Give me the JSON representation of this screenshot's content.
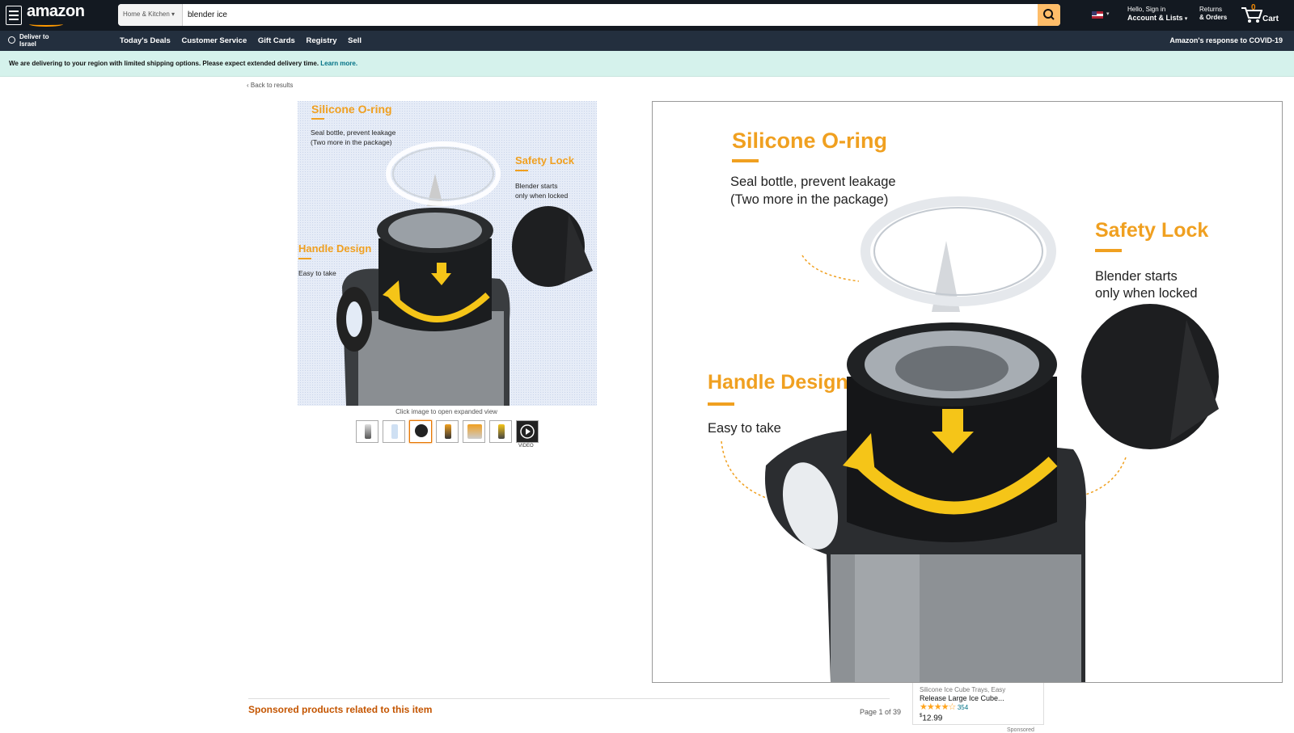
{
  "header": {
    "logo": "amazon",
    "search_category": "Home & Kitchen",
    "search_query": "blender ice",
    "account_line1": "Hello, Sign in",
    "account_line2": "Account & Lists",
    "returns_line1": "Returns",
    "returns_line2": "& Orders",
    "cart_count": "0",
    "cart_label": "Cart"
  },
  "subnav": {
    "deliver_line1": "Deliver to",
    "deliver_line2": "Israel",
    "links": [
      "Today's Deals",
      "Customer Service",
      "Gift Cards",
      "Registry",
      "Sell"
    ],
    "covid": "Amazon's response to COVID-19"
  },
  "banner": {
    "text": "We are delivering to your region with limited shipping options. Please expect extended delivery time.",
    "link": "Learn more."
  },
  "back_link": "‹ Back to results",
  "image": {
    "silicone_title": "Silicone O-ring",
    "silicone_desc1": "Seal bottle, prevent leakage",
    "silicone_desc2": "(Two more in the package)",
    "safety_title": "Safety Lock",
    "safety_desc1": "Blender starts",
    "safety_desc2": "only when locked",
    "handle_title": "Handle Design",
    "handle_desc": "Easy to take",
    "caption": "Click image to open expanded view",
    "video_label": "VIDEO",
    "thumb_count": 7
  },
  "sponsored": {
    "heading": "Sponsored products related to this item",
    "page_info": "Page 1 of 39"
  },
  "side_card": {
    "title1": "Silicone Ice Cube Trays, Easy",
    "title2": "Release Large Ice Cube...",
    "stars": "★★★★☆",
    "rating": 4.5,
    "reviews": "354",
    "price_sym": "$",
    "price": "12.99",
    "sponsored_label": "Sponsored"
  },
  "colors": {
    "orange_text": "#f0a020",
    "nav_dark": "#131921",
    "nav_secondary": "#232f3e",
    "banner_bg": "#d5f2ec",
    "sponsored_heading": "#c45500"
  }
}
